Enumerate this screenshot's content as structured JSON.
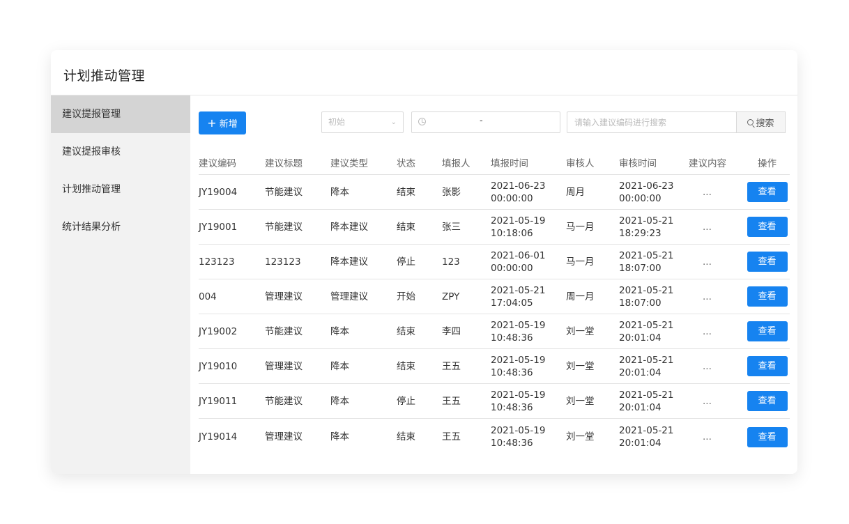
{
  "page_title": "计划推动管理",
  "sidebar": {
    "items": [
      {
        "label": "建议提报管理",
        "active": true
      },
      {
        "label": "建议提报审核",
        "active": false
      },
      {
        "label": "计划推动管理",
        "active": false
      },
      {
        "label": "统计结果分析",
        "active": false
      }
    ]
  },
  "toolbar": {
    "add_icon": "plus-icon",
    "add_label": "新增",
    "status_select_value": "初始",
    "date_range_icon": "clock-icon",
    "date_range_separator": "-",
    "search_placeholder": "请输入建议编码进行搜索",
    "search_icon": "search-icon",
    "search_button_label": "搜索"
  },
  "table": {
    "columns": [
      "建议编码",
      "建议标题",
      "建议类型",
      "状态",
      "填报人",
      "填报时间",
      "审核人",
      "审核时间",
      "建议内容",
      "操作"
    ],
    "rows": [
      {
        "code": "JY19004",
        "title": "节能建议",
        "type": "降本",
        "status": "结束",
        "reporter": "张影",
        "report_date": "2021-06-23",
        "report_time": "00:00:00",
        "reviewer": "周月",
        "review_date": "2021-06-23",
        "review_time": "00:00:00",
        "content": "...",
        "action": "查看"
      },
      {
        "code": "JY19001",
        "title": "节能建议",
        "type": "降本建议",
        "status": "结束",
        "reporter": "张三",
        "report_date": "2021-05-19",
        "report_time": "10:18:06",
        "reviewer": "马一月",
        "review_date": "2021-05-21",
        "review_time": "18:29:23",
        "content": "...",
        "action": "查看"
      },
      {
        "code": "123123",
        "title": "123123",
        "type": "降本建议",
        "status": "停止",
        "reporter": "123",
        "report_date": "2021-06-01",
        "report_time": "00:00:00",
        "reviewer": "马一月",
        "review_date": "2021-05-21",
        "review_time": "18:07:00",
        "content": "...",
        "action": "查看"
      },
      {
        "code": "004",
        "title": "管理建议",
        "type": "管理建议",
        "status": "开始",
        "reporter": "ZPY",
        "report_date": "2021-05-21",
        "report_time": "17:04:05",
        "reviewer": "周一月",
        "review_date": "2021-05-21",
        "review_time": "18:07:00",
        "content": "...",
        "action": "查看"
      },
      {
        "code": "JY19002",
        "title": "节能建议",
        "type": "降本",
        "status": "结束",
        "reporter": "李四",
        "report_date": "2021-05-19",
        "report_time": "10:48:36",
        "reviewer": "刘一堂",
        "review_date": "2021-05-21",
        "review_time": "20:01:04",
        "content": "...",
        "action": "查看"
      },
      {
        "code": "JY19010",
        "title": "管理建议",
        "type": "降本",
        "status": "结束",
        "reporter": "王五",
        "report_date": "2021-05-19",
        "report_time": "10:48:36",
        "reviewer": "刘一堂",
        "review_date": "2021-05-21",
        "review_time": "20:01:04",
        "content": "...",
        "action": "查看"
      },
      {
        "code": "JY19011",
        "title": "节能建议",
        "type": "降本",
        "status": "停止",
        "reporter": "王五",
        "report_date": "2021-05-19",
        "report_time": "10:48:36",
        "reviewer": "刘一堂",
        "review_date": "2021-05-21",
        "review_time": "20:01:04",
        "content": "...",
        "action": "查看"
      },
      {
        "code": "JY19014",
        "title": "管理建议",
        "type": "降本",
        "status": "结束",
        "reporter": "王五",
        "report_date": "2021-05-19",
        "report_time": "10:48:36",
        "reviewer": "刘一堂",
        "review_date": "2021-05-21",
        "review_time": "20:01:04",
        "content": "...",
        "action": "查看"
      }
    ]
  },
  "colors": {
    "accent": "#1683f0",
    "sidebar_bg": "#f2f2f2",
    "sidebar_active": "#d4d4d4"
  }
}
